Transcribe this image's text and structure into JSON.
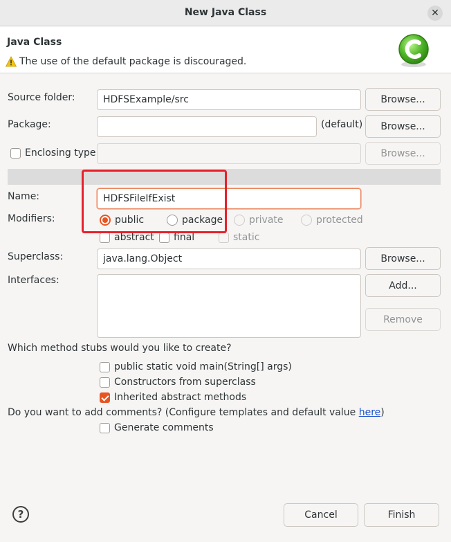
{
  "window": {
    "title": "New Java Class"
  },
  "header": {
    "title": "Java Class",
    "warning": "The use of the default package is discouraged."
  },
  "source_folder": {
    "label": "Source folder:",
    "value": "HDFSExample/src",
    "browse_label": "Browse..."
  },
  "package": {
    "label": "Package:",
    "value": "",
    "default_label": "(default)",
    "browse_label": "Browse..."
  },
  "enclosing_type": {
    "label": "Enclosing type:",
    "value": "",
    "browse_label": "Browse..."
  },
  "name": {
    "label": "Name:",
    "value": "HDFSFileIfExist"
  },
  "modifiers": {
    "label": "Modifiers:",
    "access": [
      "public",
      "package",
      "private",
      "protected"
    ],
    "selected": "public",
    "abstract_label": "abstract",
    "final_label": "final",
    "static_label": "static"
  },
  "superclass": {
    "label": "Superclass:",
    "value": "java.lang.Object",
    "browse_label": "Browse..."
  },
  "interfaces": {
    "label": "Interfaces:",
    "add_label": "Add...",
    "remove_label": "Remove"
  },
  "stubs": {
    "question": "Which method stubs would you like to create?",
    "main_label": "public static void main(String[] args)",
    "constructors_label": "Constructors from superclass",
    "inherited_label": "Inherited abstract methods"
  },
  "comments": {
    "question": "Do you want to add comments? (Configure templates and default value ",
    "link": "here",
    "question_end": ")",
    "generate_label": "Generate comments"
  },
  "footer": {
    "help": "?",
    "cancel_label": "Cancel",
    "finish_label": "Finish"
  },
  "colors": {
    "accent": "#e95420",
    "highlight": "#e8202a",
    "link": "#1a4fc9"
  }
}
